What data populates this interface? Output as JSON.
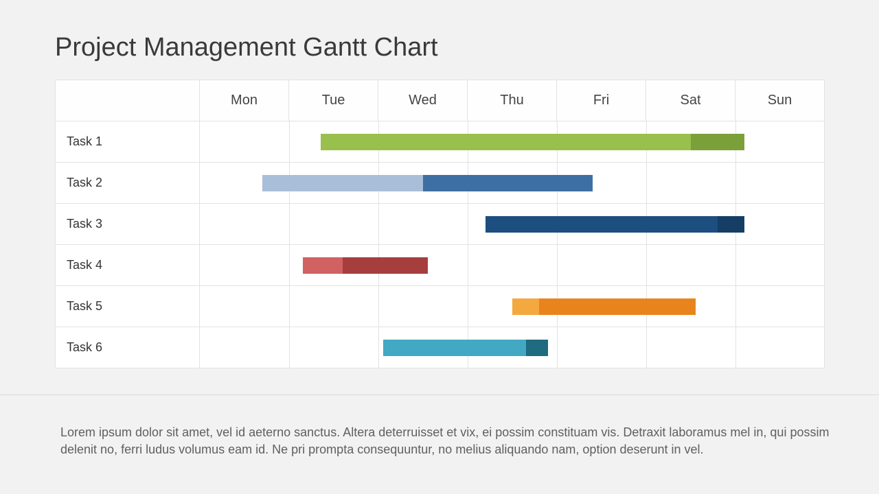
{
  "title": "Project Management Gantt Chart",
  "days": [
    "Mon",
    "Tue",
    "Wed",
    "Thu",
    "Fri",
    "Sat",
    "Sun"
  ],
  "tasks": [
    {
      "label": "Task 1",
      "segments": [
        {
          "start": 1.35,
          "end": 5.5,
          "color": "#99C04C"
        },
        {
          "start": 5.5,
          "end": 6.1,
          "color": "#7BA039"
        }
      ]
    },
    {
      "label": "Task 2",
      "segments": [
        {
          "start": 0.7,
          "end": 2.5,
          "color": "#A9BFD9"
        },
        {
          "start": 2.5,
          "end": 4.4,
          "color": "#3E6FA3"
        }
      ]
    },
    {
      "label": "Task 3",
      "segments": [
        {
          "start": 3.2,
          "end": 5.8,
          "color": "#1C4E80"
        },
        {
          "start": 5.8,
          "end": 6.1,
          "color": "#163E64"
        }
      ]
    },
    {
      "label": "Task 4",
      "segments": [
        {
          "start": 1.15,
          "end": 1.6,
          "color": "#D16262"
        },
        {
          "start": 1.6,
          "end": 2.55,
          "color": "#A63E3E"
        }
      ]
    },
    {
      "label": "Task 5",
      "segments": [
        {
          "start": 3.5,
          "end": 3.8,
          "color": "#F4A840"
        },
        {
          "start": 3.8,
          "end": 5.55,
          "color": "#E9841C"
        }
      ]
    },
    {
      "label": "Task 6",
      "segments": [
        {
          "start": 2.05,
          "end": 3.65,
          "color": "#42A8C4"
        },
        {
          "start": 3.65,
          "end": 3.9,
          "color": "#1F6B7F"
        }
      ]
    }
  ],
  "footer_text": "Lorem ipsum dolor sit amet, vel id aeterno sanctus. Altera deterruisset et vix, ei possim constituam vis. Detraxit laborामus mel in, qui possim delenit no, ferri ludus volumus eam id. Ne pri prompta consequuntur, no melius aliquando nam, option deserunt in vel.",
  "footer_text_fixed": "Lorem ipsum dolor sit amet, vel id aeterno sanctus. Altera deterruisset et vix, ei possim constituam vis. Detraxit laboramus mel in, qui possim delenit no, ferri ludus volumus eam id. Ne pri prompta consequuntur, no melius aliquando nam, option deserunt in vel.",
  "chart_data": {
    "type": "bar",
    "orientation": "gantt",
    "x_axis": "days",
    "x_categories": [
      "Mon",
      "Tue",
      "Wed",
      "Thu",
      "Fri",
      "Sat",
      "Sun"
    ],
    "series": [
      {
        "name": "Task 1",
        "start_day": "Tue",
        "end_day": "Sat",
        "start": 1.35,
        "end": 6.1,
        "phase_split": 5.5,
        "colors": [
          "#99C04C",
          "#7BA039"
        ]
      },
      {
        "name": "Task 2",
        "start_day": "Mon",
        "end_day": "Fri",
        "start": 0.7,
        "end": 4.4,
        "phase_split": 2.5,
        "colors": [
          "#A9BFD9",
          "#3E6FA3"
        ]
      },
      {
        "name": "Task 3",
        "start_day": "Thu",
        "end_day": "Sat",
        "start": 3.2,
        "end": 6.1,
        "phase_split": 5.8,
        "colors": [
          "#1C4E80",
          "#163E64"
        ]
      },
      {
        "name": "Task 4",
        "start_day": "Tue",
        "end_day": "Wed",
        "start": 1.15,
        "end": 2.55,
        "phase_split": 1.6,
        "colors": [
          "#D16262",
          "#A63E3E"
        ]
      },
      {
        "name": "Task 5",
        "start_day": "Thu",
        "end_day": "Sat",
        "start": 3.5,
        "end": 5.55,
        "phase_split": 3.8,
        "colors": [
          "#F4A840",
          "#E9841C"
        ]
      },
      {
        "name": "Task 6",
        "start_day": "Wed",
        "end_day": "Thu",
        "start": 2.05,
        "end": 3.9,
        "phase_split": 3.65,
        "colors": [
          "#42A8C4",
          "#1F6B7F"
        ]
      }
    ],
    "title": "Project Management Gantt Chart"
  }
}
